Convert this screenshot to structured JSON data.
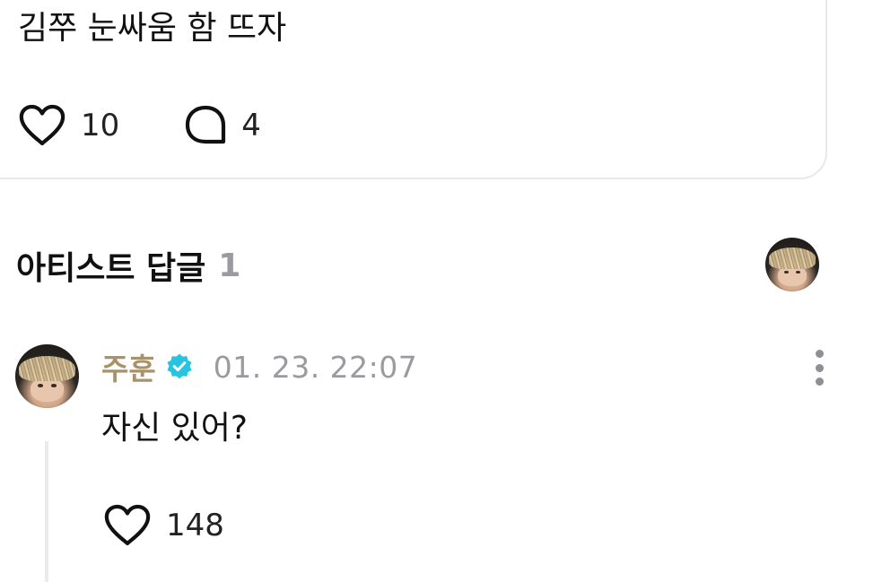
{
  "post": {
    "text": "김쭈 눈싸움 함 뜨자",
    "like_count": "10",
    "comment_count": "4"
  },
  "section": {
    "title": "아티스트 답글",
    "count": "1"
  },
  "comment": {
    "author": "주훈",
    "timestamp": "01. 23. 22:07",
    "text": "자신 있어?",
    "like_count": "148"
  },
  "icons": {
    "like": "heart-outline-icon",
    "comment": "speech-bubble-icon",
    "verified": "verified-badge-icon",
    "more": "more-vertical-icon"
  },
  "colors": {
    "author_name": "#a8926a",
    "verified_badge": "#27c4e0",
    "timestamp": "#9a9aa0",
    "section_count": "#9a9aa0",
    "card_border": "#e8e8ee"
  }
}
